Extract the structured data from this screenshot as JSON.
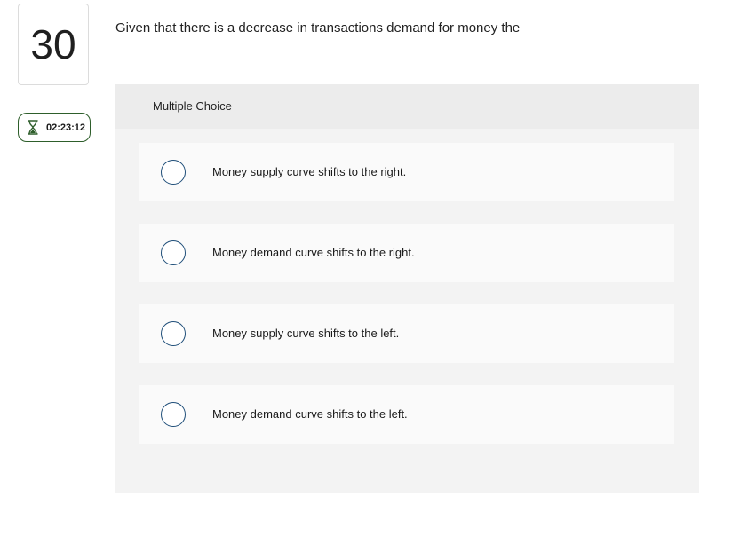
{
  "question": {
    "number": "30",
    "text": "Given that there is a decrease in transactions demand for money the"
  },
  "timer": {
    "value": "02:23:12",
    "icon": "hourglass-icon",
    "color": "#2e5e2b"
  },
  "panel": {
    "label": "Multiple Choice"
  },
  "options": [
    {
      "text": "Money supply curve shifts to the right."
    },
    {
      "text": "Money demand curve shifts to the right."
    },
    {
      "text": "Money supply curve shifts to the left."
    },
    {
      "text": "Money demand curve shifts to the left."
    }
  ],
  "colors": {
    "radio_border": "#1f4e79",
    "panel_bg": "#f3f3f3",
    "option_bg": "#fafafa"
  }
}
